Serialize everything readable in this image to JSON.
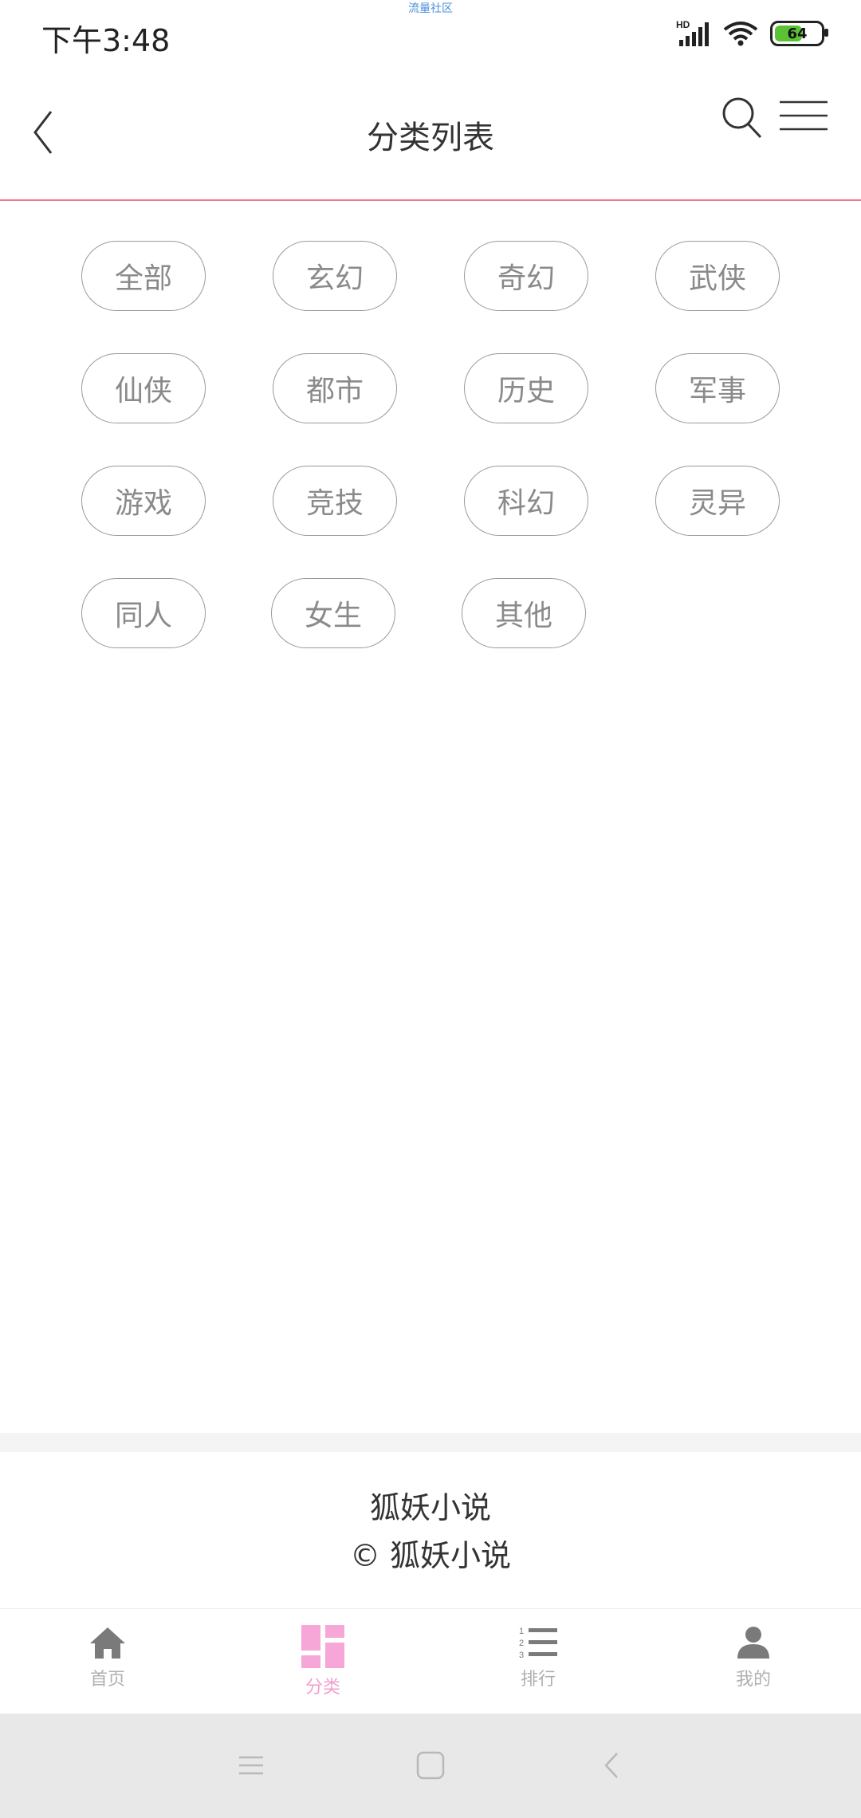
{
  "status_bar": {
    "time": "下午3:48",
    "notice": "流量社区",
    "signal_label": "HD",
    "battery": "64",
    "battery_level": 0.64
  },
  "header": {
    "title": "分类列表",
    "back_icon": "chevron-left-icon",
    "search_icon": "search-icon",
    "menu_icon": "hamburger-menu-icon"
  },
  "categories": [
    "全部",
    "玄幻",
    "奇幻",
    "武侠",
    "仙侠",
    "都市",
    "历史",
    "军事",
    "游戏",
    "竞技",
    "科幻",
    "灵异",
    "同人",
    "女生",
    "其他"
  ],
  "footer": {
    "site_name": "狐妖小说",
    "copyright": "© 狐妖小说"
  },
  "tabs": [
    {
      "label": "首页",
      "icon": "home-icon",
      "active": false
    },
    {
      "label": "分类",
      "icon": "category-grid-icon",
      "active": true
    },
    {
      "label": "排行",
      "icon": "ranking-list-icon",
      "active": false
    },
    {
      "label": "我的",
      "icon": "user-icon",
      "active": false
    }
  ],
  "colors": {
    "accent": "#f29fcf",
    "header_border": "#f0788f",
    "pill_border": "#9a9a9a",
    "pill_text": "#8a8a8a"
  }
}
